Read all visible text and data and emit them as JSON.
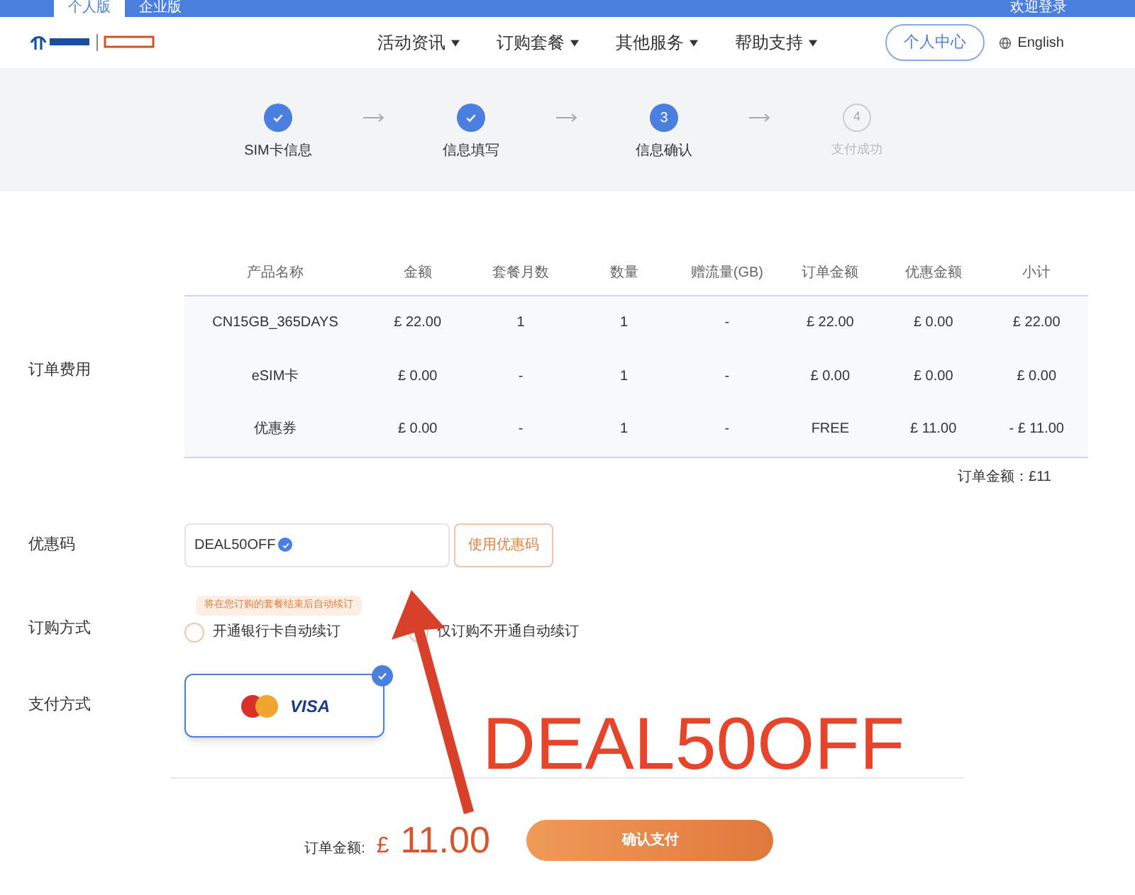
{
  "top_bar": {
    "tabs": [
      {
        "label": "个人版",
        "selected": true
      },
      {
        "label": "企业版",
        "selected": false
      }
    ],
    "login": "欢迎登录"
  },
  "header": {
    "nav": [
      {
        "label": "活动资讯"
      },
      {
        "label": "订购套餐"
      },
      {
        "label": "其他服务"
      },
      {
        "label": "帮助支持"
      }
    ],
    "account_button": "个人中心",
    "language": "English"
  },
  "steps": [
    {
      "kind": "done",
      "label": "SIM卡信息"
    },
    {
      "kind": "done",
      "label": "信息填写"
    },
    {
      "kind": "current",
      "label": "信息确认",
      "number": "3"
    },
    {
      "kind": "pending",
      "label": "支付成功",
      "number": "4"
    }
  ],
  "order_fee": {
    "label": "订单费用",
    "columns": [
      "产品名称",
      "金额",
      "套餐月数",
      "数量",
      "赠流量(GB)",
      "订单金额",
      "优惠金额",
      "小计"
    ],
    "rows": [
      [
        "CN15GB_365DAYS",
        "£ 22.00",
        "1",
        "1",
        "-",
        "£ 22.00",
        "£ 0.00",
        "£ 22.00"
      ],
      [
        "eSIM卡",
        "£ 0.00",
        "-",
        "1",
        "-",
        "£ 0.00",
        "£ 0.00",
        "£ 0.00"
      ],
      [
        "优惠券",
        "£ 0.00",
        "-",
        "1",
        "-",
        "FREE",
        "£ 11.00",
        "- £ 11.00"
      ]
    ],
    "total": "订单金额：£11"
  },
  "promo": {
    "label": "优惠码",
    "value": "DEAL50OFF",
    "verified": true,
    "button": "使用优惠码"
  },
  "subscription": {
    "label": "订购方式",
    "tooltip": "将在您订购的套餐结束后自动续订",
    "options": [
      {
        "label": "开通银行卡自动续订",
        "selected": false
      },
      {
        "label": "仅订购不开通自动续订",
        "selected": false
      }
    ]
  },
  "payment": {
    "label": "支付方式",
    "methods": [
      {
        "name": "VISA",
        "selected": true
      }
    ]
  },
  "footer": {
    "total_label": "订单金额:",
    "currency": "£",
    "amount": "11.00",
    "confirm_button": "确认支付"
  },
  "annotation": {
    "text": "DEAL50OFF"
  }
}
